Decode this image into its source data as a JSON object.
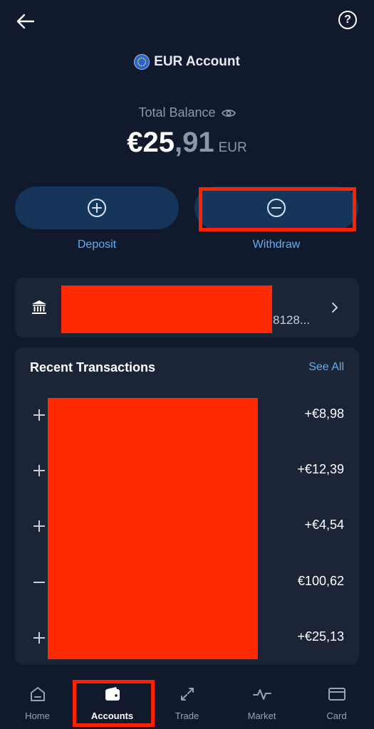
{
  "header": {
    "back_icon": "arrow-left-icon",
    "help_label": "?"
  },
  "account": {
    "title": "EUR Account",
    "flag_icon": "eu-flag-icon"
  },
  "balance": {
    "label": "Total Balance",
    "main": "€25",
    "decimal": ",91",
    "currency": "EUR"
  },
  "actions": {
    "deposit_label": "Deposit",
    "withdraw_label": "Withdraw"
  },
  "bank": {
    "icon": "bank-icon",
    "account_suffix": "8128..."
  },
  "transactions": {
    "title": "Recent Transactions",
    "see_all": "See All",
    "items": [
      {
        "sign": "plus",
        "amount": "+€8,98"
      },
      {
        "sign": "plus",
        "amount": "+€12,39"
      },
      {
        "sign": "plus",
        "amount": "+€4,54"
      },
      {
        "sign": "minus",
        "amount": "€100,62"
      },
      {
        "sign": "plus",
        "amount": "+€25,13"
      }
    ]
  },
  "nav": {
    "items": [
      {
        "label": "Home",
        "icon": "home-icon"
      },
      {
        "label": "Accounts",
        "icon": "wallet-icon"
      },
      {
        "label": "Trade",
        "icon": "trade-arrows-icon"
      },
      {
        "label": "Market",
        "icon": "pulse-chart-icon"
      },
      {
        "label": "Card",
        "icon": "credit-card-icon"
      }
    ],
    "active": "Accounts"
  },
  "colors": {
    "background": "#111a2c",
    "card": "#1c2537",
    "accent": "#5eaef6",
    "button": "#15365a",
    "highlight": "#ff2200"
  }
}
